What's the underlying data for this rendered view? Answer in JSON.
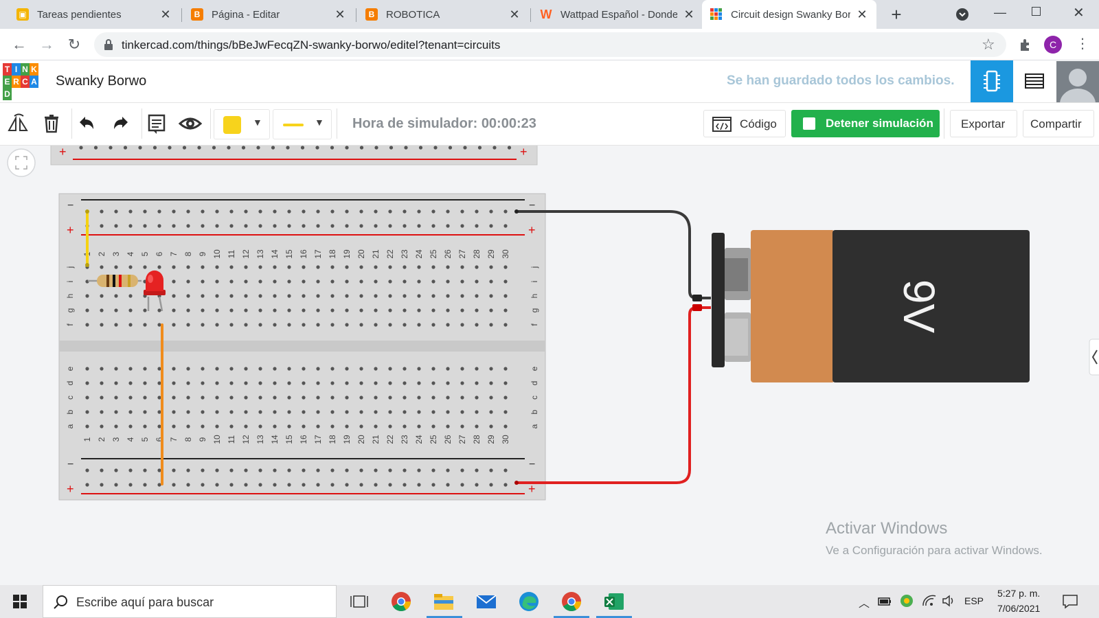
{
  "browser": {
    "tabs": [
      {
        "title": "Tareas pendientes",
        "icon": "classroom-icon",
        "color": "#f4b400"
      },
      {
        "title": "Página - Editar",
        "icon": "blogger-icon",
        "color": "#f57d00"
      },
      {
        "title": "ROBOTICA",
        "icon": "blogger-icon",
        "color": "#f57d00"
      },
      {
        "title": "Wattpad Español - Donde",
        "icon": "wattpad-icon",
        "color": "#ff6122"
      },
      {
        "title": "Circuit design Swanky Bor",
        "icon": "tinkercad-icon",
        "color": "#1b98e0"
      }
    ],
    "url": "tinkercad.com/things/bBeJwFecqZN-swanky-borwo/editel?tenant=circuits",
    "profile_initial": "C"
  },
  "app": {
    "logo_letters": [
      "T",
      "I",
      "N",
      "K",
      "E",
      "R",
      "C",
      "A",
      "D"
    ],
    "title": "Swanky Borwo",
    "saved_status": "Se han guardado todos los cambios."
  },
  "toolbar": {
    "sim_time": "Hora de simulador: 00:00:23",
    "code_label": "Código",
    "stop_label": "Detener simulación",
    "export_label": "Exportar",
    "share_label": "Compartir",
    "color_swatch": "#f7d31c"
  },
  "breadboard": {
    "rows_top": [
      "j",
      "i",
      "h",
      "g",
      "f"
    ],
    "rows_bottom": [
      "e",
      "d",
      "c",
      "b",
      "a"
    ],
    "columns": [
      "1",
      "2",
      "3",
      "4",
      "5",
      "6",
      "7",
      "8",
      "9",
      "10",
      "11",
      "12",
      "13",
      "14",
      "15",
      "16",
      "17",
      "18",
      "19",
      "20",
      "21",
      "22",
      "23",
      "24",
      "25",
      "26",
      "27",
      "28",
      "29",
      "30"
    ],
    "minus": "−",
    "plus": "+"
  },
  "battery": {
    "label": "9V"
  },
  "watermark": {
    "line1": "Activar Windows",
    "line2": "Ve a Configuración para activar Windows."
  },
  "taskbar": {
    "search_placeholder": "Escribe aquí para buscar",
    "language": "ESP",
    "time": "5:27 p. m.",
    "date": "7/06/2021"
  }
}
